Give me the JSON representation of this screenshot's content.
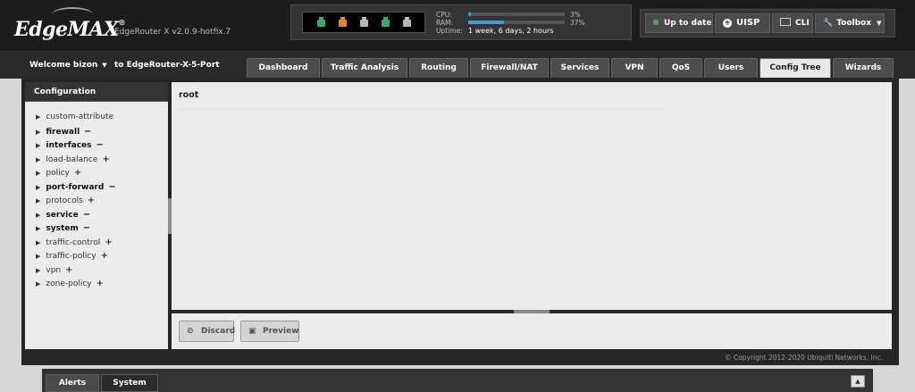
{
  "header": {
    "logo_text": "EdgeMAX",
    "logo_tm": "®",
    "model_version": "EdgeRouter X v2.0.9-hotfix.7",
    "ports": [
      {
        "color": "#2fae6a"
      },
      {
        "color": "#e6892c"
      },
      {
        "color": "#b8b8b8"
      },
      {
        "color": "#2fae6a"
      },
      {
        "color": "#b8b8b8"
      }
    ],
    "stats": {
      "cpu_label": "CPU:",
      "cpu_value": "3%",
      "cpu_fraction": 0.03,
      "ram_label": "RAM:",
      "ram_value": "37%",
      "ram_fraction": 0.37,
      "uptime_label": "Uptime:",
      "uptime_value": "1 week, 6 days, 2 hours"
    },
    "tools": {
      "update_label": "Up to date",
      "uisp_label": "UISP",
      "cli_label": "CLI",
      "toolbox_label": "Toolbox"
    }
  },
  "nav": {
    "welcome": "Welcome bizon",
    "router_name": "to EdgeRouter-X-5-Port",
    "tabs": [
      {
        "label": "Dashboard"
      },
      {
        "label": "Traffic Analysis"
      },
      {
        "label": "Routing"
      },
      {
        "label": "Firewall/NAT"
      },
      {
        "label": "Services"
      },
      {
        "label": "VPN"
      },
      {
        "label": "QoS"
      },
      {
        "label": "Users"
      },
      {
        "label": "Config Tree",
        "active": true
      },
      {
        "label": "Wizards"
      }
    ]
  },
  "sidebar": {
    "title": "Configuration",
    "items": [
      {
        "label": "custom-attribute",
        "bold": false,
        "mark": ""
      },
      {
        "label": "firewall",
        "bold": true,
        "mark": "−"
      },
      {
        "label": "interfaces",
        "bold": true,
        "mark": "−"
      },
      {
        "label": "load-balance",
        "bold": false,
        "mark": "+"
      },
      {
        "label": "policy",
        "bold": false,
        "mark": "+"
      },
      {
        "label": "port-forward",
        "bold": true,
        "mark": "−"
      },
      {
        "label": "protocols",
        "bold": false,
        "mark": "+"
      },
      {
        "label": "service",
        "bold": true,
        "mark": "−"
      },
      {
        "label": "system",
        "bold": true,
        "mark": "−"
      },
      {
        "label": "traffic-control",
        "bold": false,
        "mark": "+"
      },
      {
        "label": "traffic-policy",
        "bold": false,
        "mark": "+"
      },
      {
        "label": "vpn",
        "bold": false,
        "mark": "+"
      },
      {
        "label": "zone-policy",
        "bold": false,
        "mark": "+"
      }
    ]
  },
  "content": {
    "root_label": "root",
    "discard_label": "Discard",
    "preview_label": "Preview"
  },
  "footer": {
    "copyright": "© Copyright 2012-2020 Ubiquiti Networks, Inc.",
    "bottom_tabs": [
      {
        "label": "Alerts"
      },
      {
        "label": "System",
        "active": true
      }
    ]
  }
}
